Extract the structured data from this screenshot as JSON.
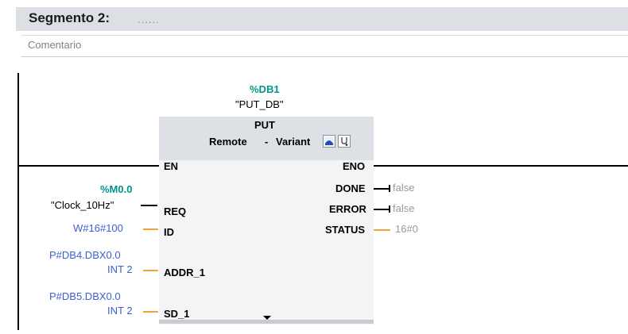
{
  "segment": {
    "title": "Segmento 2:",
    "dots": "......",
    "comment": "Comentario"
  },
  "block": {
    "db_address": "%DB1",
    "db_name": "\"PUT_DB\"",
    "title": "PUT",
    "remote_label": "Remote",
    "separator": "-",
    "variant_label": "Variant",
    "icons": [
      "block-view-icon",
      "stethoscope-icon"
    ]
  },
  "inputs": {
    "en": "EN",
    "req": {
      "pin": "REQ",
      "operand_address": "%M0.0",
      "operand_name": "\"Clock_10Hz\""
    },
    "id": {
      "pin": "ID",
      "value": "W#16#100"
    },
    "addr_1": {
      "pin": "ADDR_1",
      "pointer": "P#DB4.DBX0.0",
      "type": "INT 2"
    },
    "sd_1": {
      "pin": "SD_1",
      "pointer": "P#DB5.DBX0.0",
      "type": "INT 2"
    }
  },
  "outputs": {
    "eno": "ENO",
    "done": {
      "pin": "DONE",
      "value": "false"
    },
    "error": {
      "pin": "ERROR",
      "value": "false"
    },
    "status": {
      "pin": "STATUS",
      "value": "16#0"
    }
  },
  "colors": {
    "header_bg": "#dcdfe3",
    "block_bg": "#f2f4f6",
    "db_address": "#00948a",
    "constant_blue": "#3b5fd1",
    "wire_orange": "#f0a43c",
    "value_gray": "#9a9a9a"
  }
}
